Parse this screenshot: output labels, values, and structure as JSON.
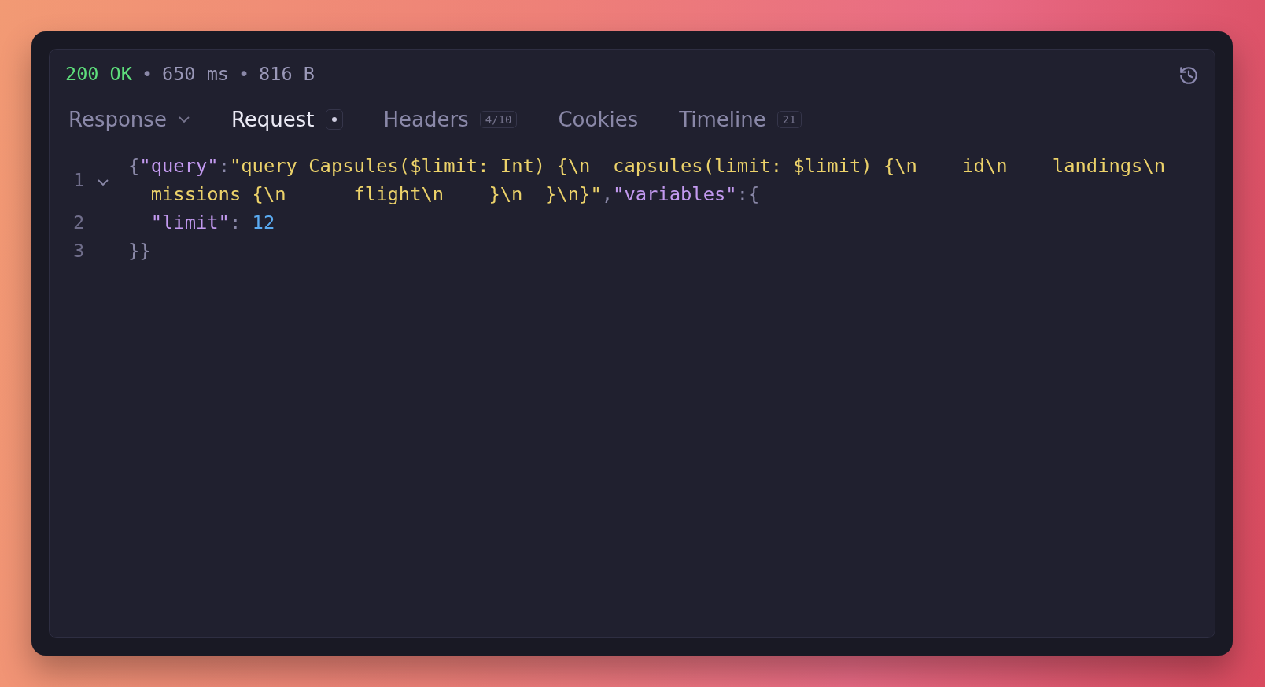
{
  "status": {
    "code": "200 OK",
    "separator_1": "•",
    "time": "650 ms",
    "separator_2": "•",
    "size": "816 B"
  },
  "tabs": [
    {
      "label": "Response",
      "selected": false,
      "dropdown": true
    },
    {
      "label": "Request",
      "selected": true,
      "modified": true
    },
    {
      "label": "Headers",
      "selected": false,
      "badge": "4/10"
    },
    {
      "label": "Cookies",
      "selected": false
    },
    {
      "label": "Timeline",
      "selected": false,
      "badge": "21"
    }
  ],
  "code_lines": [
    {
      "number": "1",
      "expanded": true,
      "segments": [
        {
          "tokens": [
            {
              "kind": "punct",
              "text": "{"
            },
            {
              "kind": "key",
              "text": "\"query\""
            },
            {
              "kind": "punct",
              "text": ":"
            },
            {
              "kind": "string",
              "text": "\"query Capsules($limit: Int) {\\n  capsules(limit: $limit) {\\n    id\\n    landings\\n"
            }
          ]
        },
        {
          "tokens": [
            {
              "kind": "string",
              "text": "  missions {\\n      flight\\n    }\\n  }\\n}\""
            },
            {
              "kind": "punct",
              "text": ","
            },
            {
              "kind": "key",
              "text": "\"variables\""
            },
            {
              "kind": "punct",
              "text": ":{"
            }
          ]
        }
      ]
    },
    {
      "number": "2",
      "segments": [
        {
          "tokens": [
            {
              "kind": "key",
              "text": "  \"limit\""
            },
            {
              "kind": "punct",
              "text": ": "
            },
            {
              "kind": "number",
              "text": "12"
            }
          ]
        }
      ]
    },
    {
      "number": "3",
      "segments": [
        {
          "tokens": [
            {
              "kind": "punct",
              "text": "}}"
            }
          ]
        }
      ]
    }
  ]
}
